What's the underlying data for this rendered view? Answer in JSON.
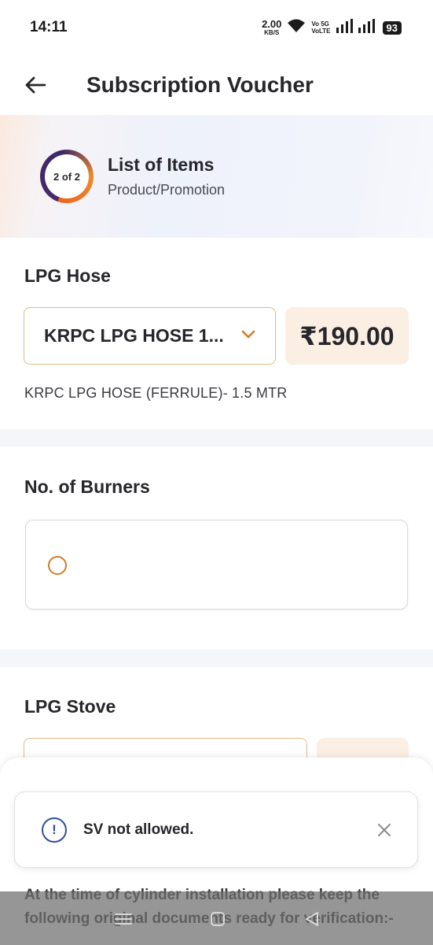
{
  "status_bar": {
    "time": "14:11",
    "net_speed_value": "2.00",
    "net_speed_unit": "KB/S",
    "volte_line1": "Vo 5G",
    "volte_line2": "VoLTE",
    "battery": "93"
  },
  "app_bar": {
    "title": "Subscription Voucher"
  },
  "step": {
    "progress": "2 of 2",
    "title": "List of Items",
    "subtitle": "Product/Promotion"
  },
  "lpg_hose": {
    "label": "LPG Hose",
    "selected": "KRPC LPG HOSE 1...",
    "price": "₹190.00",
    "description": "KRPC LPG HOSE (FERRULE)- 1.5 MTR"
  },
  "burners": {
    "label": "No. of Burners"
  },
  "lpg_stove": {
    "label": "LPG Stove"
  },
  "bottom_sheet": {
    "text": "At the time of cylinder installation please keep the following original documents ready for verification:-"
  },
  "toast": {
    "message": "SV not allowed."
  },
  "colors": {
    "accent": "#d47a2a",
    "info": "#2f4e9a",
    "price_bg": "#fbeee2"
  }
}
